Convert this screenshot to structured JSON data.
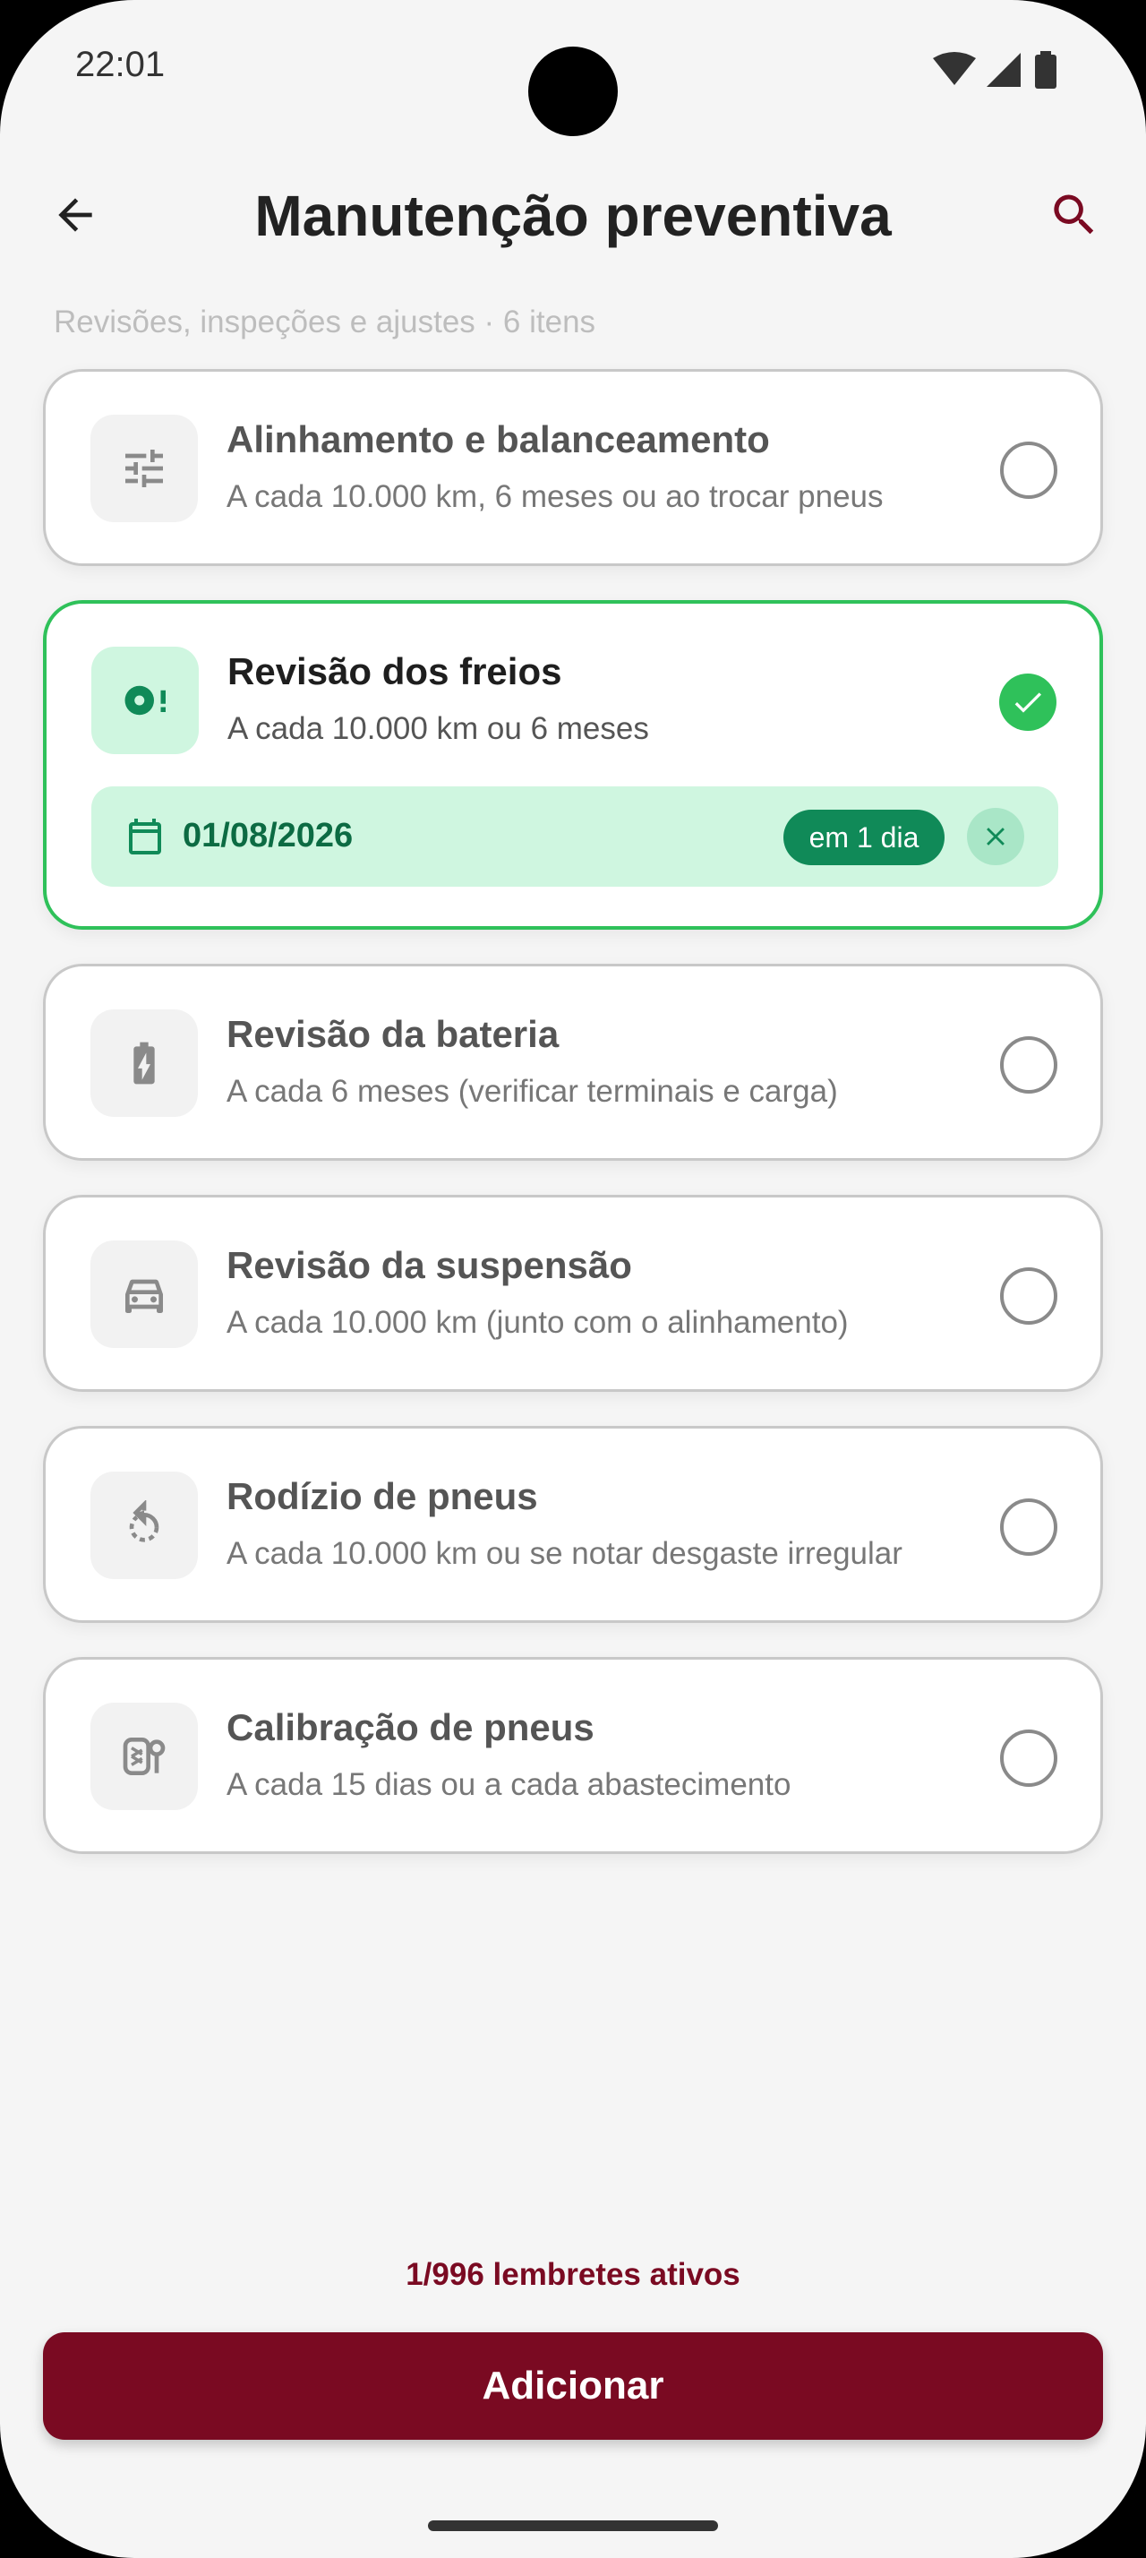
{
  "status_bar": {
    "time": "22:01"
  },
  "header": {
    "title": "Manutenção preventiva"
  },
  "subtitle": "Revisões, inspeções e ajustes · 6 itens",
  "items": [
    {
      "title": "Alinhamento e balanceamento",
      "description": "A cada 10.000 km, 6 meses ou ao trocar pneus",
      "icon": "sliders-icon",
      "selected": false
    },
    {
      "title": "Revisão dos freios",
      "description": "A cada 10.000 km ou 6 meses",
      "icon": "brake-warning-icon",
      "selected": true,
      "date": "01/08/2026",
      "badge": "em 1 dia"
    },
    {
      "title": "Revisão da bateria",
      "description": "A cada 6 meses (verificar terminais e carga)",
      "icon": "battery-charging-icon",
      "selected": false
    },
    {
      "title": "Revisão da suspensão",
      "description": "A cada 10.000 km (junto com o alinhamento)",
      "icon": "car-icon",
      "selected": false
    },
    {
      "title": "Rodízio de pneus",
      "description": "A cada 10.000 km ou se notar desgaste irregular",
      "icon": "rotate-icon",
      "selected": false
    },
    {
      "title": "Calibração de pneus",
      "description": "A cada 15 dias ou a cada abastecimento",
      "icon": "tire-pressure-icon",
      "selected": false
    }
  ],
  "footer": {
    "reminders": "1/996 lembretes ativos",
    "add_label": "Adicionar"
  },
  "colors": {
    "brand": "#7a0a22",
    "success": "#2fc15a",
    "success_bg": "#cff6e0",
    "success_dark": "#108a58"
  }
}
